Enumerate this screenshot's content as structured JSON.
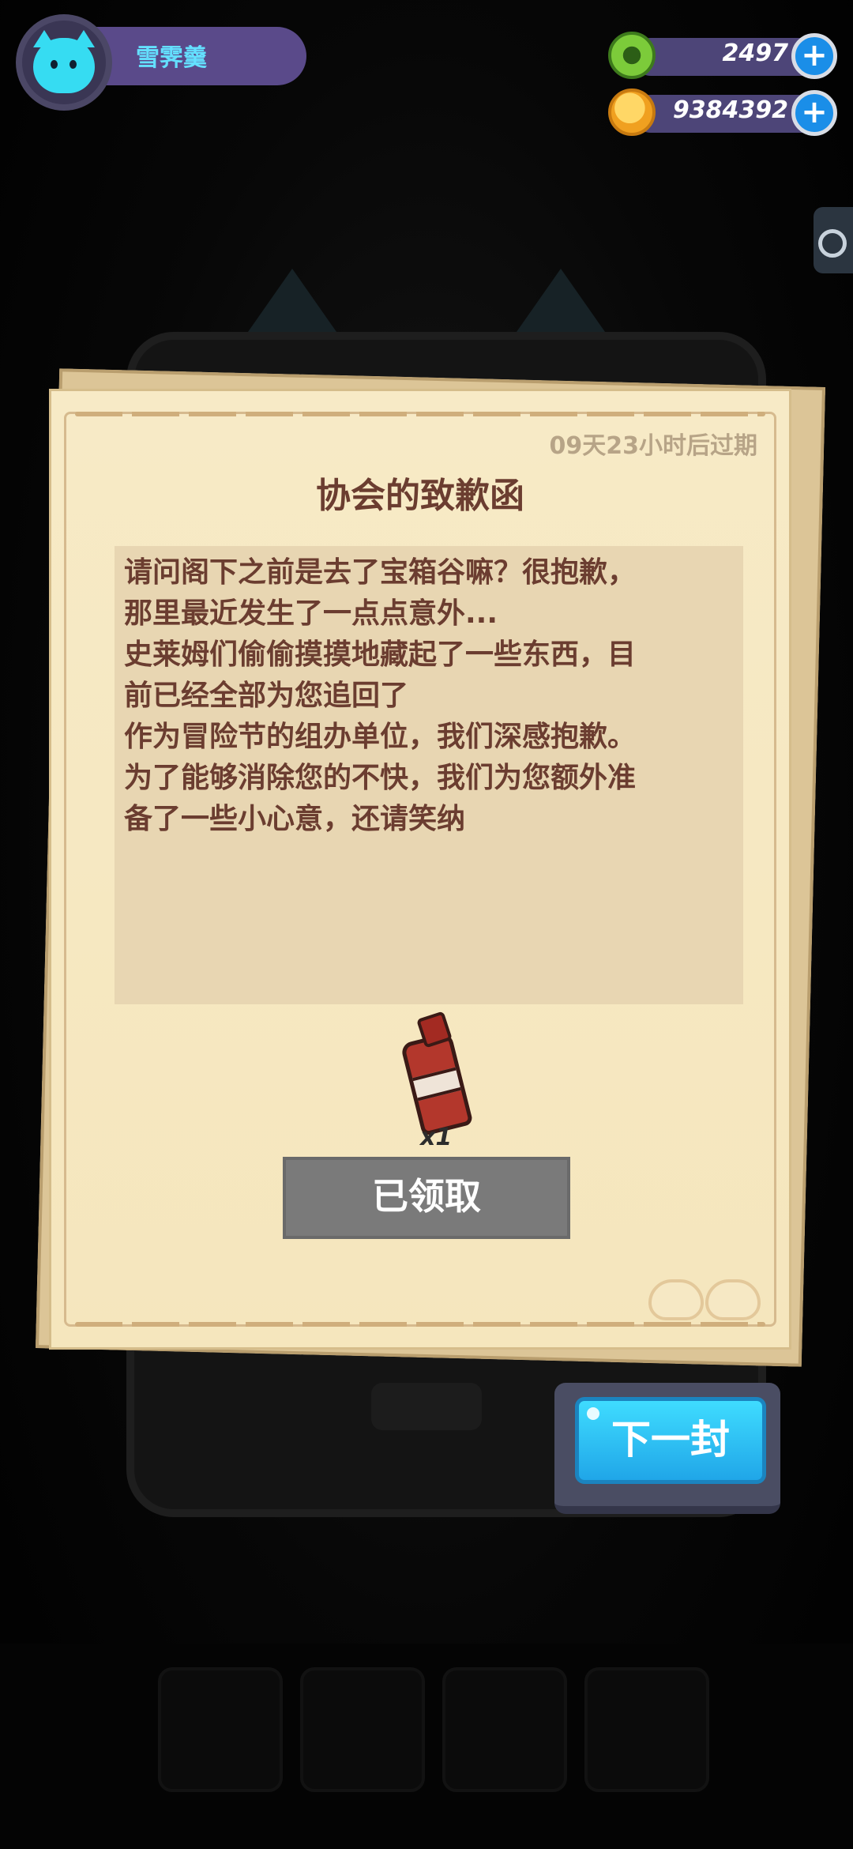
{
  "player": {
    "name": "雪霁羹"
  },
  "currencies": [
    {
      "icon": "green-gem-icon",
      "value": "2497"
    },
    {
      "icon": "coin-planet-icon",
      "value": "9384392"
    }
  ],
  "plus_label": "+",
  "letter": {
    "expire_text": "09天23小时后过期",
    "title": "协会的致歉函",
    "body_lines": [
      "请问阁下之前是去了宝箱谷嘛？很抱歉，",
      "那里最近发生了一点点意外...",
      "史莱姆们偷偷摸摸地藏起了一些东西，目",
      "前已经全部为您追回了",
      "作为冒险节的组办单位，我们深感抱歉。",
      "为了能够消除您的不快，我们为您额外准",
      "备了一些小心意，还请笑纳"
    ],
    "reward": {
      "icon": "potion-bottle-icon",
      "count": "x1"
    },
    "claim_button": "已领取"
  },
  "next_button": "下一封",
  "colors": {
    "paper": "#f7eac6",
    "title_text": "#6b3d30",
    "next_button": "#2fbff2",
    "claimed_button": "#7a7a7a"
  }
}
